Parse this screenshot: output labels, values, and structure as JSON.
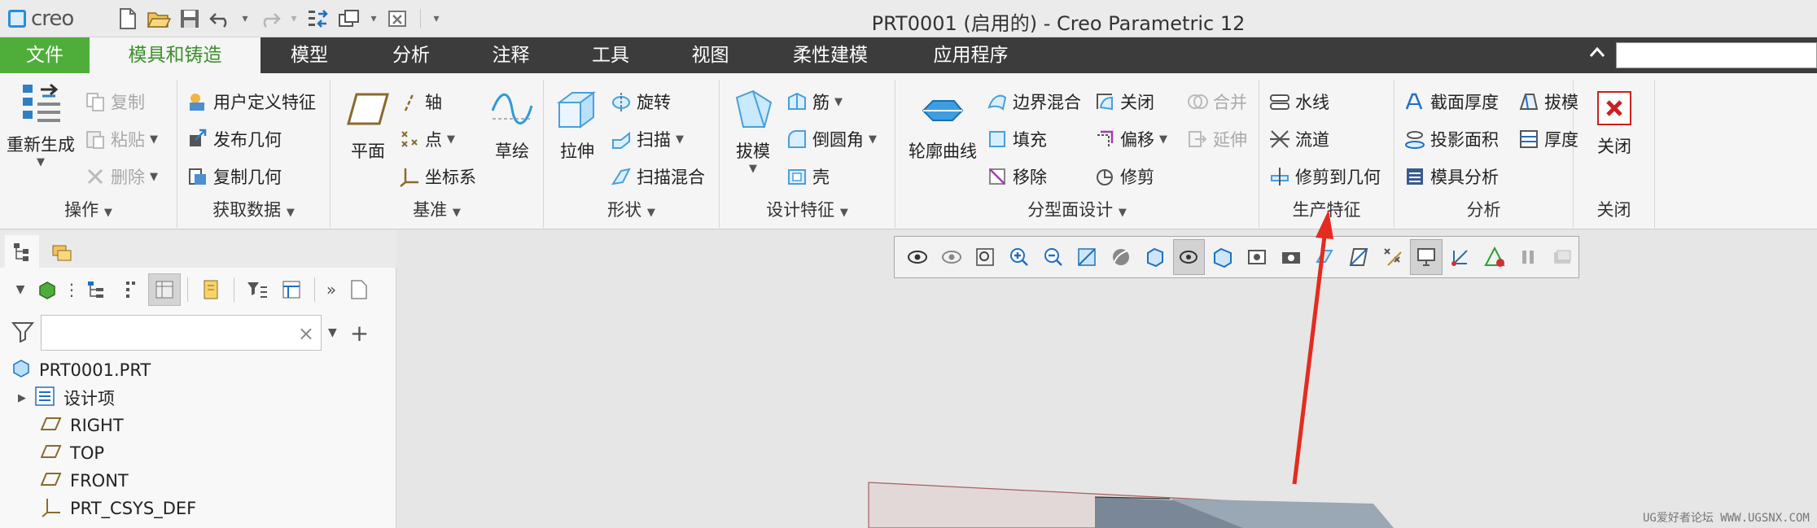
{
  "app": {
    "logo": "creo",
    "window_title": "PRT0001 (启用的) - Creo Parametric 12"
  },
  "quick_access": [
    "new-icon",
    "open-icon",
    "save-icon",
    "undo-icon",
    "redo-icon",
    "regenerate-icon",
    "windows-icon",
    "close-window-icon",
    "customize-icon"
  ],
  "tabs": [
    "文件",
    "模具和铸造",
    "模型",
    "分析",
    "注释",
    "工具",
    "视图",
    "柔性建模",
    "应用程序"
  ],
  "active_tab": "模具和铸造",
  "ribbon": {
    "ops": {
      "regen": "重新生成",
      "copy": "复制",
      "paste": "粘贴",
      "delete": "删除",
      "label": "操作"
    },
    "getdata": {
      "udf": "用户定义特征",
      "publish": "发布几何",
      "copygeom": "复制几何",
      "label": "获取数据"
    },
    "datum": {
      "plane": "平面",
      "axis": "轴",
      "point": "点",
      "csys": "坐标系",
      "sketch": "草绘",
      "label": "基准"
    },
    "shapes": {
      "extrude": "拉伸",
      "revolve": "旋转",
      "sweep": "扫描",
      "sweepblend": "扫描混合",
      "label": "形状"
    },
    "design": {
      "draft": "拔模",
      "rib": "筋",
      "round": "倒圆角",
      "shell": "壳",
      "label": "设计特征"
    },
    "parting": {
      "silhouette": "轮廓曲线",
      "boundary": "边界混合",
      "fill": "填充",
      "remove": "移除",
      "close": "关闭",
      "offset": "偏移",
      "trim": "修剪",
      "merge": "合并",
      "extend": "延伸",
      "label": "分型面设计"
    },
    "prod": {
      "waterline": "水线",
      "runner": "流道",
      "trimgeom": "修剪到几何",
      "label": "生产特征"
    },
    "analysis": {
      "section": "截面厚度",
      "draft": "拔模",
      "projarea": "投影面积",
      "thickness": "厚度",
      "moldanalysis": "模具分析",
      "label": "分析"
    },
    "closegrp": {
      "close": "关闭",
      "label": "关闭"
    }
  },
  "tree": {
    "root": "PRT0001.PRT",
    "items": [
      "设计项",
      "RIGHT",
      "TOP",
      "FRONT",
      "PRT_CSYS_DEF"
    ]
  },
  "filter": {
    "placeholder": ""
  },
  "watermark": "UG爱好者论坛 WWW.UGSNX.COM",
  "colors": {
    "accent_green": "#4fae3a",
    "tab_dark": "#3c3c3c",
    "annotation_red": "#e52b1f"
  }
}
